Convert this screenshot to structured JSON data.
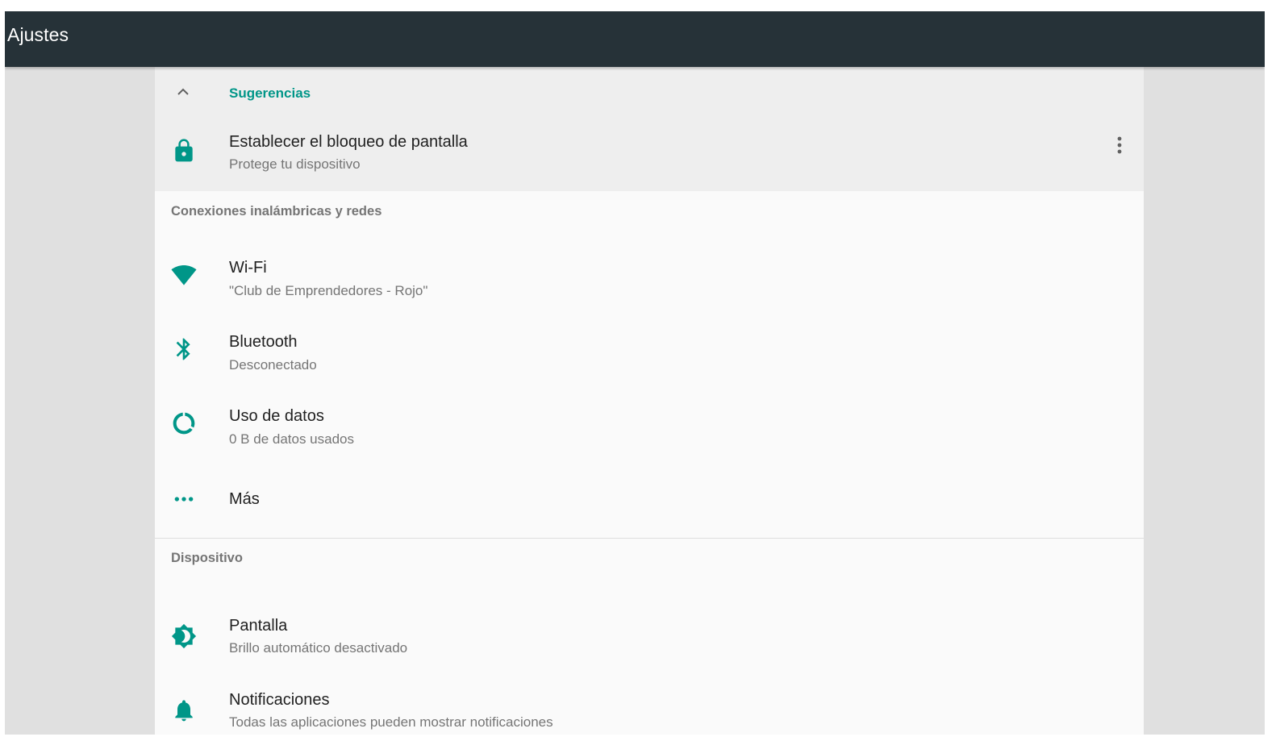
{
  "app_bar": {
    "title": "Ajustes"
  },
  "suggestions": {
    "header": "Sugerencias",
    "items": [
      {
        "title": "Establecer el bloqueo de pantalla",
        "summary": "Protege tu dispositivo",
        "icon": "lock-icon"
      }
    ],
    "overflow_icon": "more-vert-icon",
    "collapse_icon": "chevron-up-icon"
  },
  "categories": [
    {
      "title": "Conexiones inalámbricas y redes",
      "items": [
        {
          "title": "Wi-Fi",
          "summary": "\"Club de Emprendedores - Rojo\"",
          "icon": "wifi-icon"
        },
        {
          "title": "Bluetooth",
          "summary": "Desconectado",
          "icon": "bluetooth-icon"
        },
        {
          "title": "Uso de datos",
          "summary": "0 B de datos usados",
          "icon": "data-usage-icon"
        },
        {
          "title": "Más",
          "icon": "more-horiz-icon"
        }
      ]
    },
    {
      "title": "Dispositivo",
      "items": [
        {
          "title": "Pantalla",
          "summary": "Brillo automático desactivado",
          "icon": "brightness-icon"
        },
        {
          "title": "Notificaciones",
          "summary": "Todas las aplicaciones pueden mostrar notificaciones",
          "icon": "bell-icon"
        }
      ]
    }
  ],
  "colors": {
    "app_bar": "#263238",
    "accent": "#009688",
    "background": "#e0e0e0",
    "content": "#fafafa",
    "suggestions_bg": "#eeeeee",
    "primary_text": "#212121",
    "secondary_text": "#757575"
  }
}
